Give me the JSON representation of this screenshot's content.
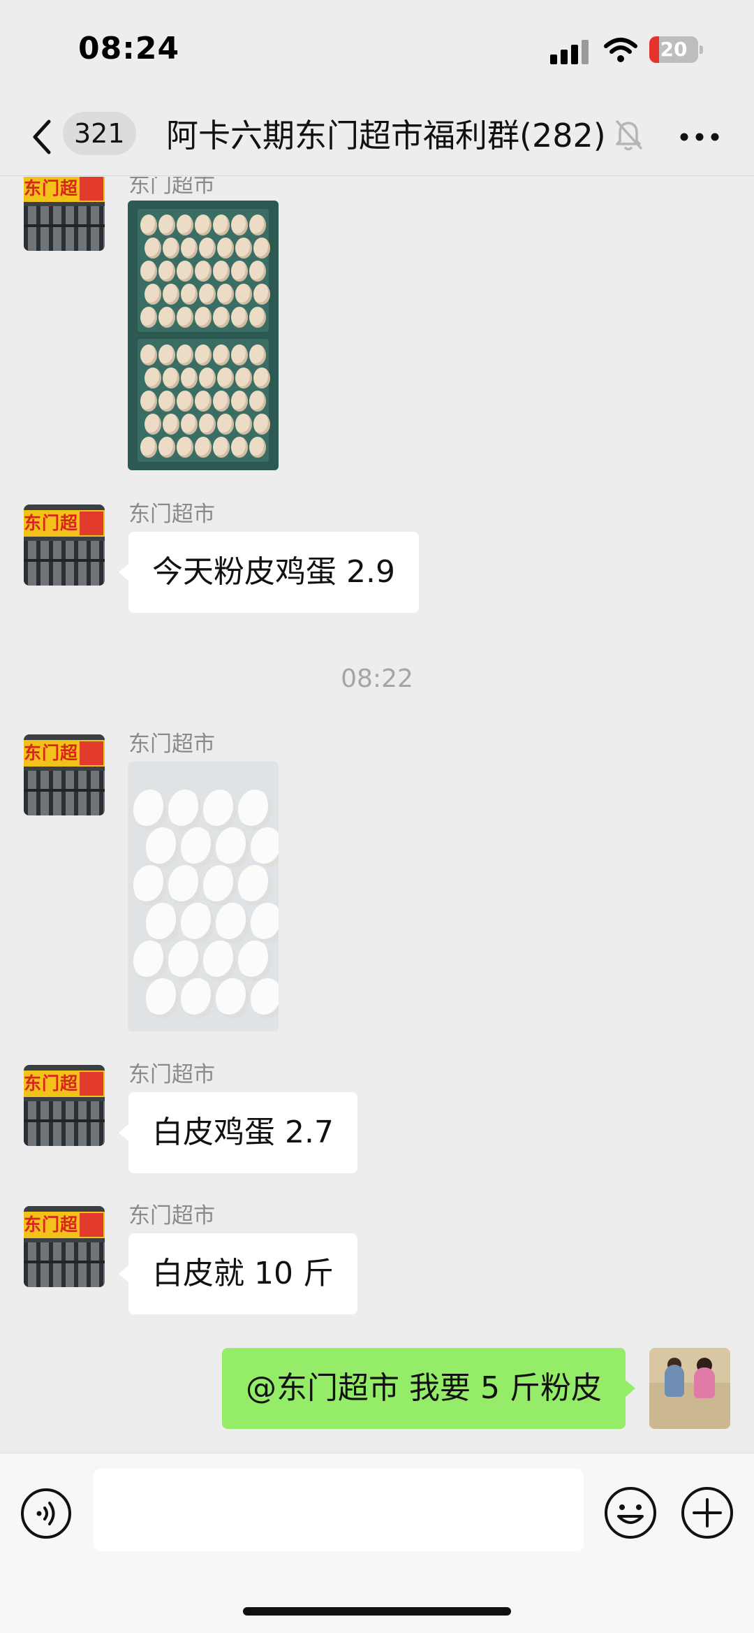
{
  "status_bar": {
    "time": "08:24",
    "battery_level": "20",
    "icons": [
      "signal-icon",
      "wifi-icon",
      "battery-icon"
    ]
  },
  "header": {
    "back_icon": "chevron-left-icon",
    "unread_count": "321",
    "title": "阿卡六期东门超市福利群",
    "member_count": "(282)",
    "mute_icon": "bell-mute-icon",
    "more_icon": "more-dots-icon"
  },
  "messages": [
    {
      "sender": "东门超市",
      "type": "image",
      "image": "egg-crate-photo"
    },
    {
      "sender": "东门超市",
      "type": "text",
      "text": "今天粉皮鸡蛋 2.9"
    },
    {
      "type": "timestamp",
      "text": "08:22"
    },
    {
      "sender": "东门超市",
      "type": "image",
      "image": "white-eggs-bag-photo"
    },
    {
      "sender": "东门超市",
      "type": "text",
      "text": "白皮鸡蛋 2.7"
    },
    {
      "sender": "东门超市",
      "type": "text",
      "text": "白皮就 10 斤"
    },
    {
      "sender": "me",
      "type": "text",
      "text": "@东门超市 我要 5 斤粉皮"
    }
  ],
  "input_bar": {
    "voice_icon": "voice-input-icon",
    "input_value": "",
    "emoji_icon": "emoji-icon",
    "plus_icon": "plus-circle-icon"
  },
  "colors": {
    "background": "#ededed",
    "bubble_incoming": "#ffffff",
    "bubble_outgoing": "#95ec69",
    "battery_low": "#e5322d"
  }
}
